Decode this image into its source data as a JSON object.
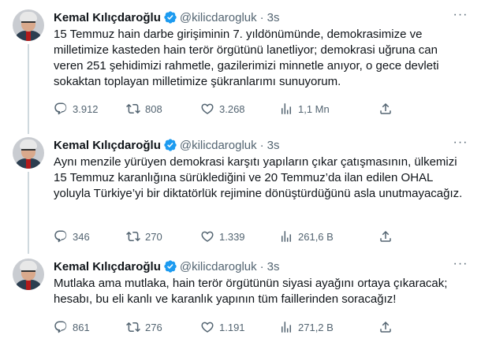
{
  "tweets": [
    {
      "name": "Kemal Kılıçdaroğlu",
      "handle": "@kilicdarogluk",
      "time": "3s",
      "text": "15 Temmuz hain darbe girişiminin 7. yıldönümünde, demokrasimize ve milletimize kasteden hain terör örgütünü lanetliyor; demokrasi uğruna can veren 251 şehidimizi rahmetle, gazilerimizi minnetle anıyor, o gece devleti sokaktan toplayan milletimize şükranlarımı sunuyorum.",
      "replies": "3.912",
      "retweets": "808",
      "likes": "3.268",
      "views": "1,1 Mn"
    },
    {
      "name": "Kemal Kılıçdaroğlu",
      "handle": "@kilicdarogluk",
      "time": "3s",
      "text": "Aynı menzile yürüyen demokrasi karşıtı yapıların çıkar çatışmasının, ülkemizi 15 Temmuz karanlığına sürüklediğini ve 20 Temmuz’da ilan edilen OHAL yoluyla Türkiye’yi bir diktatörlük rejimine dönüştürdüğünü asla unutmayacağız.",
      "replies": "346",
      "retweets": "270",
      "likes": "1.339",
      "views": "261,6 B"
    },
    {
      "name": "Kemal Kılıçdaroğlu",
      "handle": "@kilicdarogluk",
      "time": "3s",
      "text": "Mutlaka ama mutlaka, hain terör örgütünün siyasi ayağını ortaya çıkaracak; hesabı, bu eli kanlı ve karanlık yapının tüm faillerinden soracağız!",
      "replies": "861",
      "retweets": "276",
      "likes": "1.191",
      "views": "271,2 B"
    }
  ],
  "icons": {
    "verified": "verified-badge-icon",
    "more": "more-icon",
    "reply": "reply-icon",
    "retweet": "retweet-icon",
    "like": "heart-icon",
    "views": "views-icon",
    "share": "share-icon"
  },
  "colors": {
    "text": "#0f1419",
    "secondary": "#536471",
    "verified": "#1d9bf0",
    "thread_line": "#cfd9de"
  }
}
